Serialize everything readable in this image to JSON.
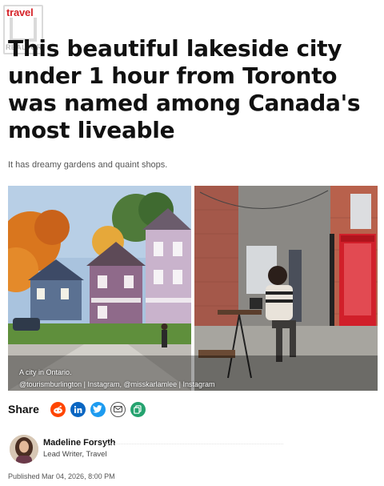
{
  "category": "travel",
  "watermark": "REALTOR",
  "headline": "This beautiful lakeside city under 1 hour from Toronto was named among Canada's most liveable",
  "subheadline": "It has dreamy gardens and quaint shops.",
  "photo": {
    "caption": "A city in Ontario.",
    "credit": "@tourismburlington | Instagram, @misskarlamlee | Instagram"
  },
  "share": {
    "label": "Share",
    "buttons": [
      {
        "icon": "reddit-icon",
        "color": "#ff4500"
      },
      {
        "icon": "linkedin-icon",
        "color": "#0a66c2"
      },
      {
        "icon": "twitter-icon",
        "color": "#1d9bf0"
      },
      {
        "icon": "email-icon",
        "color": "#666666"
      },
      {
        "icon": "copy-link-icon",
        "color": "#25a36f"
      }
    ]
  },
  "author": {
    "name": "Madeline Forsyth",
    "role": "Lead Writer, Travel"
  },
  "published": "Published Mar 04, 2026, 8:00 PM"
}
